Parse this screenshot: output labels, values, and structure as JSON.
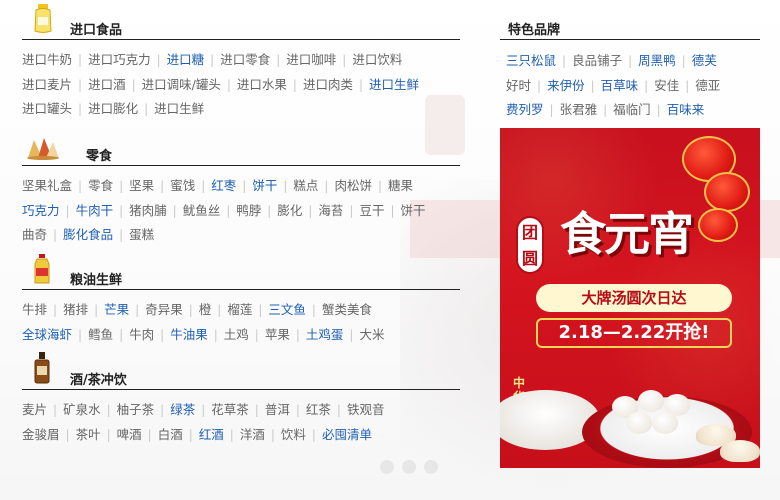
{
  "sections": [
    {
      "title": "进口食品",
      "icon": "yogurt-bottle-icon",
      "rows": [
        [
          {
            "t": "进口牛奶",
            "b": false
          },
          {
            "t": "进口巧克力",
            "b": false
          },
          {
            "t": "进口糖",
            "b": true
          },
          {
            "t": "进口零食",
            "b": false
          },
          {
            "t": "进口咖啡",
            "b": false
          },
          {
            "t": "进口饮料",
            "b": false
          }
        ],
        [
          {
            "t": "进口麦片",
            "b": false
          },
          {
            "t": "进口酒",
            "b": false
          },
          {
            "t": "进口调味/罐头",
            "b": false
          },
          {
            "t": "进口水果",
            "b": false
          },
          {
            "t": "进口肉类",
            "b": false
          },
          {
            "t": "进口生鲜",
            "b": true
          }
        ],
        [
          {
            "t": "进口罐头",
            "b": false
          },
          {
            "t": "进口膨化",
            "b": false
          },
          {
            "t": "进口生鲜",
            "b": false
          }
        ]
      ]
    },
    {
      "title": "零食",
      "icon": "snacks-icon",
      "rows": [
        [
          {
            "t": "坚果礼盒",
            "b": false
          },
          {
            "t": "零食",
            "b": false
          },
          {
            "t": "坚果",
            "b": false
          },
          {
            "t": "蜜饯",
            "b": false
          },
          {
            "t": "红枣",
            "b": true
          },
          {
            "t": "饼干",
            "b": true
          },
          {
            "t": "糕点",
            "b": false
          },
          {
            "t": "肉松饼",
            "b": false
          },
          {
            "t": "糖果",
            "b": false
          }
        ],
        [
          {
            "t": "巧克力",
            "b": true
          },
          {
            "t": "牛肉干",
            "b": true
          },
          {
            "t": "猪肉脯",
            "b": false
          },
          {
            "t": "鱿鱼丝",
            "b": false
          },
          {
            "t": "鸭脖",
            "b": false
          },
          {
            "t": "膨化",
            "b": false
          },
          {
            "t": "海苔",
            "b": false
          },
          {
            "t": "豆干",
            "b": false
          },
          {
            "t": "饼干",
            "b": false
          }
        ],
        [
          {
            "t": "曲奇",
            "b": false
          },
          {
            "t": "膨化食品",
            "b": true
          },
          {
            "t": "蛋糕",
            "b": false
          }
        ]
      ]
    },
    {
      "title": "粮油生鲜",
      "icon": "cooking-oil-icon",
      "rows": [
        [
          {
            "t": "牛排",
            "b": false
          },
          {
            "t": "猪排",
            "b": false
          },
          {
            "t": "芒果",
            "b": true
          },
          {
            "t": "奇异果",
            "b": false
          },
          {
            "t": "橙",
            "b": false
          },
          {
            "t": "榴莲",
            "b": false
          },
          {
            "t": "三文鱼",
            "b": true
          },
          {
            "t": "蟹类美食",
            "b": false
          }
        ],
        [
          {
            "t": "全球海虾",
            "b": true
          },
          {
            "t": "鳕鱼",
            "b": false
          },
          {
            "t": "牛肉",
            "b": false
          },
          {
            "t": "牛油果",
            "b": true
          },
          {
            "t": "土鸡",
            "b": false
          },
          {
            "t": "苹果",
            "b": false
          },
          {
            "t": "土鸡蛋",
            "b": true
          },
          {
            "t": "大米",
            "b": false
          }
        ]
      ]
    },
    {
      "title": "酒/茶冲饮",
      "icon": "whisky-bottle-icon",
      "rows": [
        [
          {
            "t": "麦片",
            "b": false
          },
          {
            "t": "矿泉水",
            "b": false
          },
          {
            "t": "柚子茶",
            "b": false
          },
          {
            "t": "绿茶",
            "b": true
          },
          {
            "t": "花草茶",
            "b": false
          },
          {
            "t": "普洱",
            "b": false
          },
          {
            "t": "红茶",
            "b": false
          },
          {
            "t": "铁观音",
            "b": false
          }
        ],
        [
          {
            "t": "金骏眉",
            "b": false
          },
          {
            "t": "茶叶",
            "b": false
          },
          {
            "t": "啤酒",
            "b": false
          },
          {
            "t": "白酒",
            "b": false
          },
          {
            "t": "红酒",
            "b": true
          },
          {
            "t": "洋酒",
            "b": false
          },
          {
            "t": "饮料",
            "b": false
          },
          {
            "t": "必囤清单",
            "b": true
          }
        ]
      ]
    }
  ],
  "brands": {
    "title": "特色品牌",
    "rows": [
      [
        {
          "t": "三只松鼠",
          "b": true
        },
        {
          "t": "良品铺子",
          "b": false
        },
        {
          "t": "周黑鸭",
          "b": true
        },
        {
          "t": "德芙",
          "b": true
        }
      ],
      [
        {
          "t": "好时",
          "b": false
        },
        {
          "t": "来伊份",
          "b": true
        },
        {
          "t": "百草味",
          "b": true
        },
        {
          "t": "安佳",
          "b": false
        },
        {
          "t": "德亚",
          "b": false
        }
      ],
      [
        {
          "t": "费列罗",
          "b": true
        },
        {
          "t": "张君雅",
          "b": false
        },
        {
          "t": "福临门",
          "b": false
        },
        {
          "t": "百味来",
          "b": true
        }
      ]
    ]
  },
  "ad": {
    "badge": "团圆",
    "headline": "食元宵",
    "subline": "大牌汤圆次日达",
    "date": "2.18—2.22开抢!",
    "vertical": "中华好味"
  },
  "colors": {
    "link": "#666666",
    "highlight": "#1f5fb4",
    "ad_red": "#c8101e",
    "rule": "#222222"
  }
}
